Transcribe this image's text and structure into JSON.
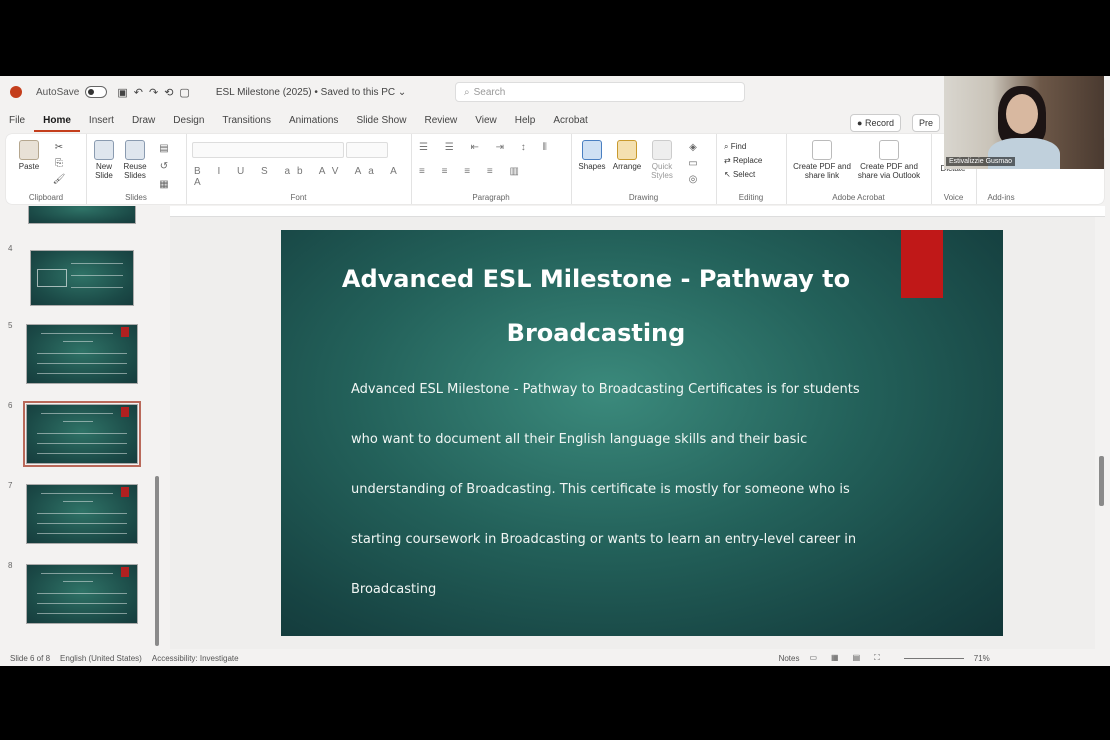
{
  "titlebar": {
    "autosave_label": "AutoSave",
    "doc_title": "ESL Milestone (2025) • Saved to this PC ⌄",
    "search_placeholder": "Search"
  },
  "tabs": [
    "File",
    "Home",
    "Insert",
    "Draw",
    "Design",
    "Transitions",
    "Animations",
    "Slide Show",
    "Review",
    "View",
    "Help",
    "Acrobat"
  ],
  "active_tab": "Home",
  "header_buttons": {
    "record": "Record",
    "present": "Pre"
  },
  "ribbon": {
    "clipboard": {
      "paste": "Paste",
      "label": "Clipboard"
    },
    "slides": {
      "new_slide": "New Slide",
      "reuse_slides": "Reuse Slides",
      "label": "Slides"
    },
    "font": {
      "label": "Font"
    },
    "paragraph": {
      "label": "Paragraph"
    },
    "drawing": {
      "shapes": "Shapes",
      "arrange": "Arrange",
      "quick_styles": "Quick Styles",
      "label": "Drawing"
    },
    "editing": {
      "find": "Find",
      "replace": "Replace",
      "select": "Select",
      "label": "Editing"
    },
    "adobe": {
      "create_pdf_share": "Create PDF and share link",
      "create_pdf_outlook": "Create PDF and share via Outlook",
      "label": "Adobe Acrobat"
    },
    "voice": {
      "dictate": "Dictate",
      "label": "Voice"
    },
    "addins": {
      "label": "Add-ins"
    }
  },
  "thumbnails": [
    {
      "num": "",
      "title": "",
      "selected": false
    },
    {
      "num": "4",
      "title": "",
      "selected": false
    },
    {
      "num": "5",
      "title": "",
      "selected": false
    },
    {
      "num": "6",
      "title": "",
      "selected": true
    },
    {
      "num": "7",
      "title": "",
      "selected": false
    },
    {
      "num": "8",
      "title": "",
      "selected": false
    }
  ],
  "slide": {
    "title": "Advanced ESL Milestone - Pathway to Broadcasting",
    "body_lines": [
      "Advanced ESL Milestone - Pathway to Broadcasting Certificates is for students",
      "who want to document all their English language skills and their basic",
      "understanding of Broadcasting. This certificate is mostly for someone who is",
      "starting coursework in Broadcasting or wants to learn an entry-level career in",
      "Broadcasting"
    ]
  },
  "statusbar": {
    "slide_info": "Slide 6 of 8",
    "language": "English (United States)",
    "accessibility": "Accessibility: Investigate",
    "notes": "Notes",
    "zoom": "71%"
  },
  "webcam": {
    "name": "Estivalizzie Gusmao"
  },
  "colors": {
    "accent": "#c43e1c",
    "slide_bg": "#23615a",
    "slide_red": "#c01818"
  }
}
